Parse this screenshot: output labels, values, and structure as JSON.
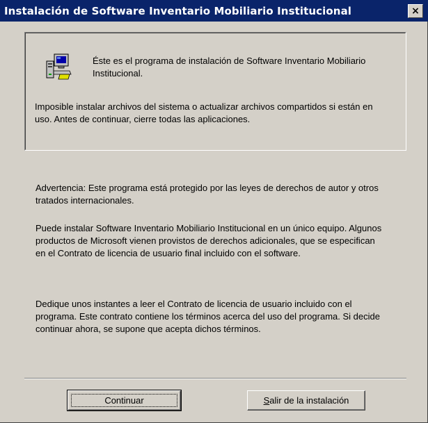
{
  "window": {
    "title": "Instalación de Software Inventario Mobiliario Institucional",
    "close_glyph": "×"
  },
  "info_panel": {
    "icon": "setup-computer-icon",
    "intro": "Éste es el programa de instalación de Software Inventario Mobiliario Institucional.",
    "warning": "Imposible instalar archivos del sistema o actualizar archivos compartidos si están en uso. Antes de continuar, cierre todas las aplicaciones."
  },
  "body": {
    "paragraph_1": "Advertencia: Este programa está protegido por las leyes de derechos de autor y otros tratados internacionales.",
    "paragraph_2": "Puede instalar Software Inventario Mobiliario Institucional en un único equipo. Algunos productos de Microsoft vienen provistos de derechos adicionales, que se especifican en el Contrato de licencia de usuario final incluido con el software.",
    "paragraph_3": "Dedique unos instantes a leer el Contrato de licencia de usuario incluido con el programa. Este contrato contiene los términos acerca del uso del programa. Si decide continuar ahora, se supone que acepta dichos términos."
  },
  "buttons": {
    "continue_label": "Continuar",
    "exit_mnemonic": "S",
    "exit_rest": "alir de la instalación"
  },
  "colors": {
    "titlebar": "#0a246a",
    "dialog_face": "#d4d0c8"
  }
}
